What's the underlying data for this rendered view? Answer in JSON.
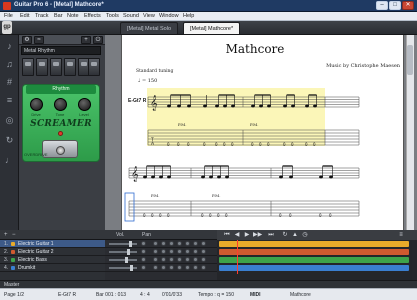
{
  "window": {
    "title": "Guitar Pro 6 - [Metal] Mathcore*",
    "buttons": {
      "minimize": "–",
      "maximize": "□",
      "close": "✕"
    }
  },
  "menu": [
    "File",
    "Edit",
    "Track",
    "Bar",
    "Note",
    "Effects",
    "Tools",
    "Sound",
    "View",
    "Window",
    "Help"
  ],
  "toolbar": {
    "logo": "gp",
    "tabs": [
      {
        "label": "[Metal] Metal Solo",
        "active": false
      },
      {
        "label": "[Metal] Mathcore*",
        "active": true
      }
    ]
  },
  "rack": {
    "preset": "Metal Rhythm",
    "pedal": {
      "channel_label": "Rhythm",
      "knobs": [
        "Drive",
        "Tone",
        "Level"
      ],
      "name": "SCREAMER",
      "sublabel": "OVERDRIVE"
    }
  },
  "score": {
    "title": "Mathcore",
    "composer": "Music by Christophe Maesen",
    "tuning": "Standard tuning",
    "tempo_marking": "♩ = 150",
    "track_label": "E-Gt7 R",
    "palm_mute": "P.M."
  },
  "tracks": {
    "header": {
      "vol": "Vol.",
      "pan": "Pan"
    },
    "items": [
      {
        "num": "1.",
        "name": "Electric Guitar 1",
        "color": "#e8aa2a",
        "selected": true
      },
      {
        "num": "2.",
        "name": "Electric Guitar 2",
        "color": "#d05a2f",
        "selected": false
      },
      {
        "num": "3.",
        "name": "Electric Bass",
        "color": "#3ea34a",
        "selected": false
      },
      {
        "num": "4.",
        "name": "Drumkit",
        "color": "#3a7fd0",
        "selected": false
      }
    ],
    "master_label": "Master"
  },
  "status": {
    "page": "Page 1/2",
    "instrument": "E-Gt7 R",
    "bar": "Bar 001 : 013",
    "time_sig": "4 : 4",
    "position": "0'01/0'33",
    "tempo": "Tempo : q = 150",
    "midi": "MIDI",
    "song": "Mathcore"
  },
  "colors": {
    "pedal_green": "#3aae57",
    "highlight": "#fbf6b8",
    "selected_track": "#3d5a88"
  }
}
